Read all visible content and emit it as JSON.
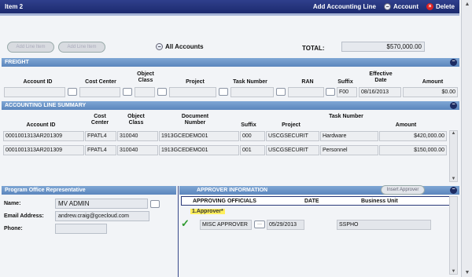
{
  "titlebar": {
    "title": "Item 2",
    "add_line": "Add Accounting Line",
    "account": "Account",
    "delete": "Delete"
  },
  "controls": {
    "btn1": "Add Line Item",
    "btn2": "Add Line Item",
    "all_accounts": "All Accounts",
    "total_label": "TOTAL:",
    "total_value": "$570,000.00"
  },
  "freight": {
    "header": "FREIGHT",
    "columns": [
      "Account ID",
      "Cost Center",
      "Object Class",
      "Project",
      "Task Number",
      "RAN",
      "Suffix",
      "Effective Date",
      "Amount"
    ],
    "suffix": "F00",
    "effective_date": "08/16/2013",
    "amount": "$0.00"
  },
  "summary": {
    "header": "ACCOUNTING LINE SUMMARY",
    "columns": [
      "Account ID",
      "Cost Center",
      "Object Class",
      "Document Number",
      "Suffix",
      "Project",
      "Task Number",
      "Amount"
    ],
    "rows": [
      [
        "0001001313AR201309",
        "FPATL4",
        "310040",
        "1913GCEDEMO01",
        "000",
        "USCGSECURIT",
        "Hardware",
        "$420,000.00"
      ],
      [
        "0001001313AR201309",
        "FPATL4",
        "310040",
        "1913GCEDEMO01",
        "001",
        "USCGSECURIT",
        "Personnel",
        "$150,000.00"
      ]
    ]
  },
  "program_office": {
    "header": "Program Office Representative",
    "name_label": "Name:",
    "name_value": "MV ADMIN",
    "email_label": "Email Address:",
    "email_value": "andrew.craig@gcecloud.com",
    "phone_label": "Phone:",
    "phone_value": ""
  },
  "approver": {
    "header": "APPROVER INFORMATION",
    "insert_btn": "Insert Approver",
    "col_officials": "APPROVING OFFICIALS",
    "col_date": "DATE",
    "col_unit": "Business Unit",
    "approver_tag": "1.Approver*",
    "approver_name": "MISC APPROVER",
    "approver_date": "05/29/2013",
    "approver_unit": "SSPHO"
  }
}
